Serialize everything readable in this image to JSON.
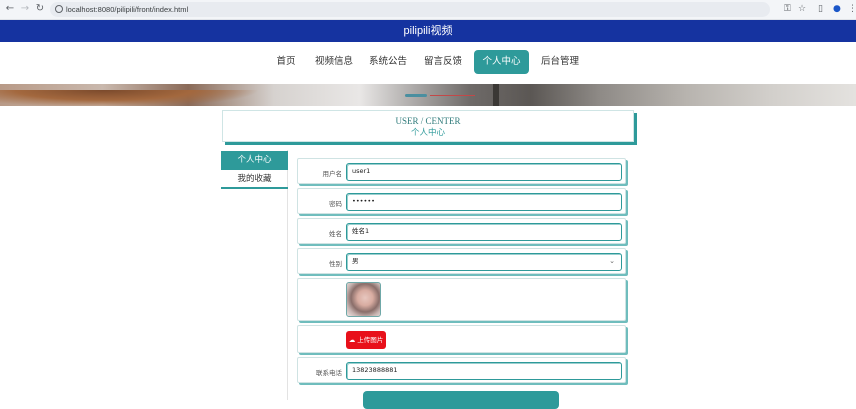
{
  "browser": {
    "url": "localhost:8080/pilipili/front/index.html"
  },
  "header": {
    "title": "pilipili视频"
  },
  "nav": {
    "items": [
      {
        "label": "首页"
      },
      {
        "label": "视频信息"
      },
      {
        "label": "系统公告"
      },
      {
        "label": "留言反馈"
      },
      {
        "label": "个人中心"
      },
      {
        "label": "后台管理"
      }
    ],
    "active_index": 4
  },
  "title_card": {
    "en": "USER / CENTER",
    "cn": "个人中心"
  },
  "side_menu": {
    "items": [
      {
        "label": "个人中心"
      },
      {
        "label": "我的收藏"
      }
    ]
  },
  "form": {
    "username": {
      "label": "用户名",
      "value": "user1"
    },
    "password": {
      "label": "密码",
      "value": "••••••"
    },
    "name": {
      "label": "姓名",
      "value": "姓名1"
    },
    "gender": {
      "label": "性别",
      "value": "男"
    },
    "upload_label": "上传图片",
    "phone": {
      "label": "联系电话",
      "value": "13823888881"
    }
  },
  "colors": {
    "header": "#1533a0",
    "accent": "#2e9a9a",
    "upload": "#e8101a"
  }
}
